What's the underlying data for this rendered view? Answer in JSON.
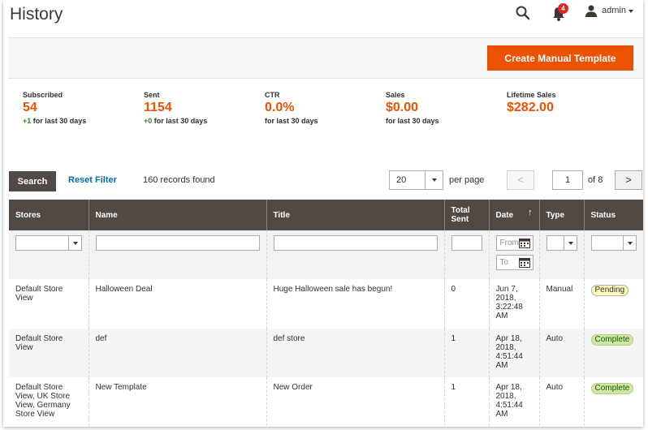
{
  "header": {
    "title": "History",
    "notification_count": "4",
    "user_name": "admin"
  },
  "actions": {
    "create_label": "Create Manual Template"
  },
  "stats": [
    {
      "label": "Subscribed",
      "value": "54",
      "delta": "+1",
      "sub": " for last 30 days"
    },
    {
      "label": "Sent",
      "value": "1154",
      "delta": "+0",
      "sub": " for last 30 days"
    },
    {
      "label": "CTR",
      "value": "0.0%",
      "delta": "",
      "sub": "for last 30 days"
    },
    {
      "label": "Sales",
      "value": "$0.00",
      "delta": "",
      "sub": "for last 30 days"
    },
    {
      "label": "Lifetime Sales",
      "value": "$282.00",
      "delta": "",
      "sub": ""
    }
  ],
  "toolbar": {
    "search_label": "Search",
    "reset_label": "Reset Filter",
    "records": "160 records found",
    "per_page_value": "20",
    "per_page_label": "per page",
    "prev_label": "<",
    "current_page": "1",
    "of_pages": "of 8",
    "next_label": ">"
  },
  "grid": {
    "columns": [
      "Stores",
      "Name",
      "Title",
      "Total Sent",
      "Date",
      "Type",
      "Status"
    ],
    "sort_indicator": "↑",
    "filters": {
      "date_from_placeholder": "From",
      "date_to_placeholder": "To"
    },
    "rows": [
      {
        "stores": "Default Store View",
        "name": "Halloween Deal",
        "title": "Huge Halloween sale has begun!",
        "total_sent": "0",
        "date": "Jun 7, 2018, 3:22:48 AM",
        "type": "Manual",
        "status": "Pending"
      },
      {
        "stores": "Default Store View",
        "name": "def",
        "title": "def store",
        "total_sent": "1",
        "date": "Apr 18, 2018, 4:51:44 AM",
        "type": "Auto",
        "status": "Complete"
      },
      {
        "stores": "Default Store View, UK Store View, Germany Store View",
        "name": "New Template",
        "title": "New Order",
        "total_sent": "1",
        "date": "Apr 18, 2018, 4:51:44 AM",
        "type": "Auto",
        "status": "Complete"
      }
    ]
  },
  "colors": {
    "accent": "#eb5202",
    "header_bg": "#514943",
    "link": "#006bb4",
    "delta_positive": "#2c8a24"
  }
}
